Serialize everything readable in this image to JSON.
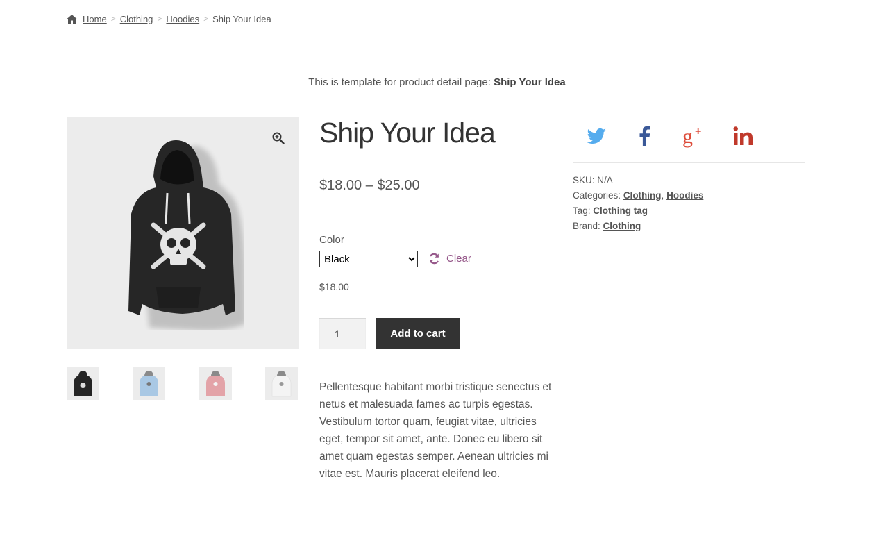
{
  "breadcrumb": {
    "home": "Home",
    "items": [
      "Clothing",
      "Hoodies"
    ],
    "current": "Ship Your Idea",
    "separator": ">"
  },
  "template_note": {
    "prefix": "This is template for  product detail page: ",
    "product": "Ship Your Idea"
  },
  "product": {
    "title": "Ship Your Idea",
    "price_range": "$18.00 – $25.00",
    "color_label": "Color",
    "color_selected": "Black",
    "clear_label": "Clear",
    "variation_price": "$18.00",
    "quantity": "1",
    "add_to_cart_label": "Add to cart",
    "description": "Pellentesque habitant morbi tristique senectus et netus et malesuada fames ac turpis egestas. Vestibulum tortor quam, feugiat vitae, ultricies eget, tempor sit amet, ante. Donec eu libero sit amet quam egestas semper. Aenean ultricies mi vitae est. Mauris placerat eleifend leo."
  },
  "gallery": {
    "thumbnails": [
      "black-hoodie",
      "blue-hoodie",
      "pink-hoodie",
      "white-hoodie"
    ]
  },
  "social": [
    "twitter-icon",
    "facebook-icon",
    "google-plus-icon",
    "linkedin-icon"
  ],
  "meta": {
    "sku_label": "SKU:",
    "sku_value": "N/A",
    "categories_label": "Categories:",
    "categories": [
      "Clothing",
      "Hoodies"
    ],
    "categories_separator": ",",
    "tag_label": "Tag:",
    "tag": "Clothing tag",
    "brand_label": "Brand:",
    "brand": "Clothing"
  },
  "colors": {
    "accent": "#96588a",
    "button": "#333333",
    "twitter": "#55acee",
    "facebook": "#3b5998",
    "google": "#dd4b39",
    "linkedin": "#c0392b"
  }
}
